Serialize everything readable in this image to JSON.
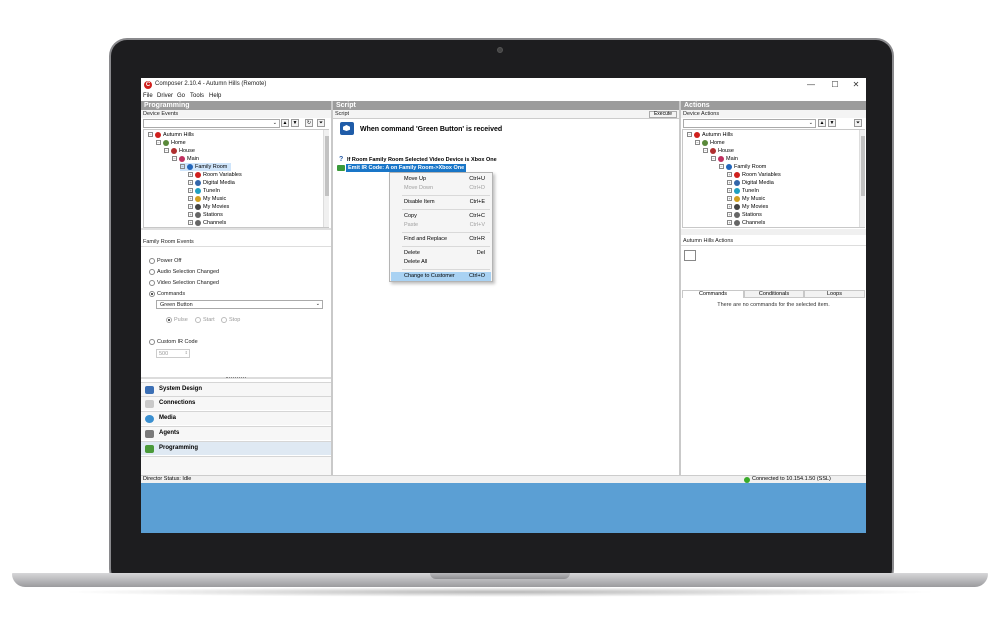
{
  "window": {
    "title": "Composer 2.10.4 - Autumn Hills (Remote)",
    "minimize": "—",
    "maximize": "☐",
    "close": "✕"
  },
  "menu": [
    "File",
    "Driver",
    "Go",
    "Tools",
    "Help"
  ],
  "programming": {
    "header": "Programming",
    "device_events_label": "Device Events",
    "tree": [
      {
        "label": "Autumn Hills",
        "level": 0,
        "color": "#d0201d"
      },
      {
        "label": "Home",
        "level": 1,
        "color": "#5a8a3a"
      },
      {
        "label": "House",
        "level": 2,
        "color": "#b03030"
      },
      {
        "label": "Main",
        "level": 3,
        "color": "#c03060"
      },
      {
        "label": "Family Room",
        "level": 4,
        "color": "#2266bb",
        "selected": true
      },
      {
        "label": "Room Variables",
        "level": 5,
        "color": "#d0201d"
      },
      {
        "label": "Digital Media",
        "level": 5,
        "color": "#3366aa"
      },
      {
        "label": "TuneIn",
        "level": 5,
        "color": "#20a0c0"
      },
      {
        "label": "My Music",
        "level": 5,
        "color": "#d0a020"
      },
      {
        "label": "My Movies",
        "level": 5,
        "color": "#444444"
      },
      {
        "label": "Stations",
        "level": 5,
        "color": "#666666"
      },
      {
        "label": "Channels",
        "level": 5,
        "color": "#666666"
      }
    ],
    "events_header": "Family Room Events",
    "events": [
      {
        "label": "Power Off",
        "selected": false
      },
      {
        "label": "Audio Selection Changed",
        "selected": false
      },
      {
        "label": "Video Selection Changed",
        "selected": false
      },
      {
        "label": "Commands",
        "selected": true
      }
    ],
    "command_value": "Green Button",
    "modes": [
      "Pulse",
      "Start",
      "Stop"
    ],
    "custom_ir_label": "Custom IR Code",
    "custom_ir_value": "500",
    "nav": [
      {
        "label": "System Design",
        "color": "#3b6fb5",
        "active": false
      },
      {
        "label": "Connections",
        "color": "#c9c9c9",
        "active": false
      },
      {
        "label": "Media",
        "color": "#3a8fd0",
        "active": false
      },
      {
        "label": "Agents",
        "color": "#7a7a7a",
        "active": false
      },
      {
        "label": "Programming",
        "color": "#4a9a3a",
        "active": true
      }
    ]
  },
  "script": {
    "header": "Script",
    "label": "Script",
    "execute": "Execute",
    "when_text": "When command 'Green Button' is received",
    "if_line": "If Room Family Room Selected Video Device is Xbox One",
    "emit_line": "Emit IR Code: A on Family Room->Xbox One"
  },
  "context_menu": [
    {
      "label": "Move Up",
      "shortcut": "Ctrl+U",
      "disabled": false
    },
    {
      "label": "Move Down",
      "shortcut": "Ctrl+D",
      "disabled": true
    },
    {
      "sep": true
    },
    {
      "label": "Disable Item",
      "shortcut": "Ctrl+E",
      "disabled": false
    },
    {
      "sep": true
    },
    {
      "label": "Copy",
      "shortcut": "Ctrl+C",
      "disabled": false
    },
    {
      "label": "Paste",
      "shortcut": "Ctrl+V",
      "disabled": true
    },
    {
      "sep": true
    },
    {
      "label": "Find and Replace",
      "shortcut": "Ctrl+R",
      "disabled": false
    },
    {
      "sep": true
    },
    {
      "label": "Delete",
      "shortcut": "Del",
      "disabled": false
    },
    {
      "label": "Delete All",
      "shortcut": "",
      "disabled": false
    },
    {
      "sep": true
    },
    {
      "label": "Change to Customer",
      "shortcut": "Ctrl+O",
      "disabled": false,
      "highlight": true
    }
  ],
  "actions": {
    "header": "Actions",
    "device_actions_label": "Device Actions",
    "tree": [
      {
        "label": "Autumn Hills",
        "level": 0,
        "color": "#d0201d"
      },
      {
        "label": "Home",
        "level": 1,
        "color": "#5a8a3a"
      },
      {
        "label": "House",
        "level": 2,
        "color": "#b03030"
      },
      {
        "label": "Main",
        "level": 3,
        "color": "#c03060"
      },
      {
        "label": "Family Room",
        "level": 4,
        "color": "#2266bb"
      },
      {
        "label": "Room Variables",
        "level": 5,
        "color": "#d0201d"
      },
      {
        "label": "Digital Media",
        "level": 5,
        "color": "#3366aa"
      },
      {
        "label": "TuneIn",
        "level": 5,
        "color": "#20a0c0"
      },
      {
        "label": "My Music",
        "level": 5,
        "color": "#d0a020"
      },
      {
        "label": "My Movies",
        "level": 5,
        "color": "#444444"
      },
      {
        "label": "Stations",
        "level": 5,
        "color": "#666666"
      },
      {
        "label": "Channels",
        "level": 5,
        "color": "#666666"
      }
    ],
    "sub_header": "Autumn Hills Actions",
    "tabs": [
      "Commands",
      "Conditionals",
      "Loops"
    ],
    "empty_text": "There are no commands for the selected item."
  },
  "status": {
    "left": "Director Status: Idle",
    "right": "Connected to 10.154.1.50 (SSL)"
  }
}
